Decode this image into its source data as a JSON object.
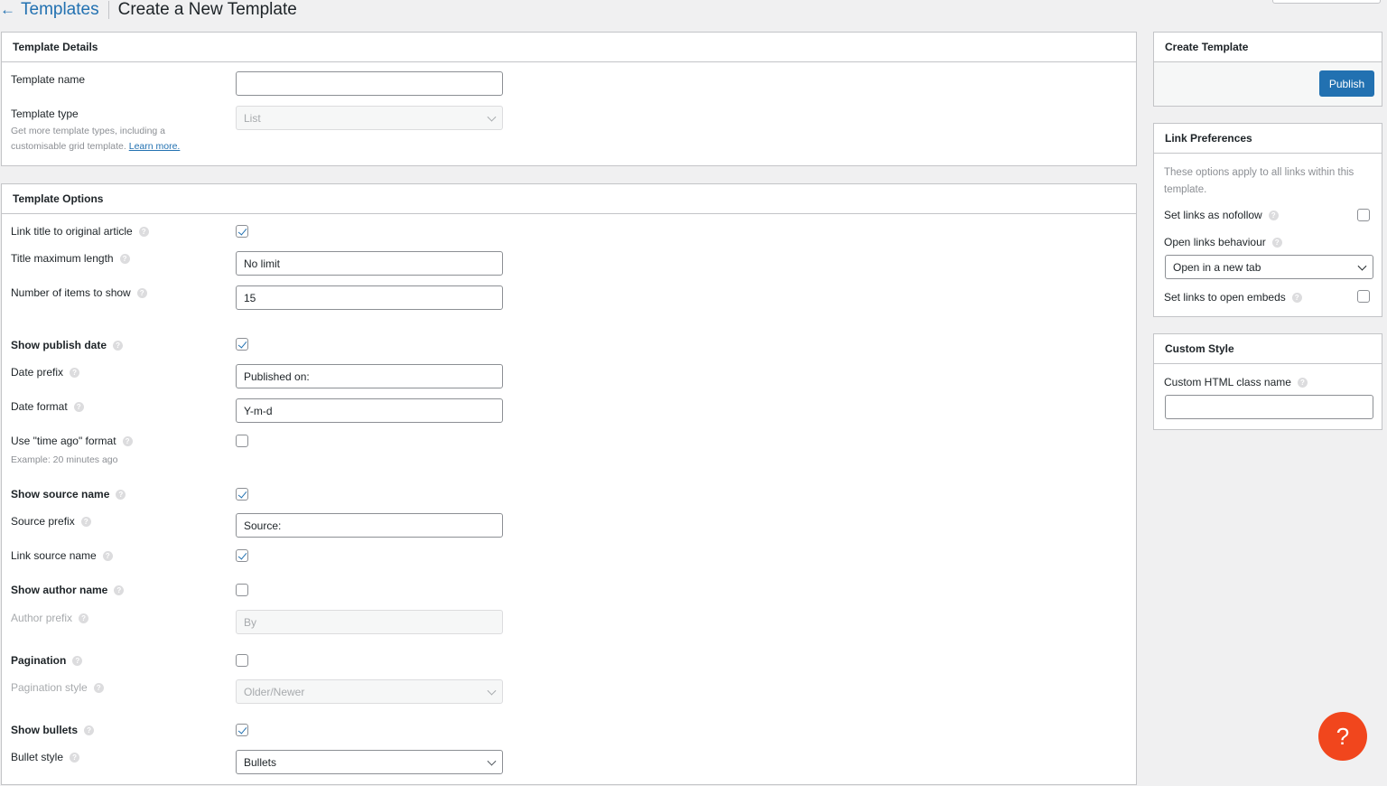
{
  "header": {
    "back_label": "Templates",
    "back_arrow": "←",
    "title": "Create a New Template"
  },
  "template_details": {
    "title": "Template Details",
    "name_label": "Template name",
    "name_value": "",
    "type_label": "Template type",
    "type_value": "List",
    "type_desc": "Get more template types, including a customisable grid template.",
    "learn_more": "Learn more."
  },
  "template_options": {
    "title": "Template Options",
    "link_title_label": "Link title to original article",
    "link_title_checked": true,
    "title_max_label": "Title maximum length",
    "title_max_value": "No limit",
    "num_items_label": "Number of items to show",
    "num_items_value": "15",
    "show_date_label": "Show publish date",
    "show_date_checked": true,
    "date_prefix_label": "Date prefix",
    "date_prefix_value": "Published on:",
    "date_format_label": "Date format",
    "date_format_value": "Y-m-d",
    "time_ago_label": "Use \"time ago\" format",
    "time_ago_checked": false,
    "time_ago_example": "Example: 20 minutes ago",
    "show_source_label": "Show source name",
    "show_source_checked": true,
    "source_prefix_label": "Source prefix",
    "source_prefix_value": "Source:",
    "link_source_label": "Link source name",
    "link_source_checked": true,
    "show_author_label": "Show author name",
    "show_author_checked": false,
    "author_prefix_label": "Author prefix",
    "author_prefix_placeholder": "By",
    "pagination_label": "Pagination",
    "pagination_checked": false,
    "pagination_style_label": "Pagination style",
    "pagination_style_value": "Older/Newer",
    "show_bullets_label": "Show bullets",
    "show_bullets_checked": true,
    "bullet_style_label": "Bullet style",
    "bullet_style_value": "Bullets"
  },
  "create_template": {
    "title": "Create Template",
    "publish_label": "Publish"
  },
  "link_prefs": {
    "title": "Link Preferences",
    "desc": "These options apply to all links within this template.",
    "nofollow_label": "Set links as nofollow",
    "nofollow_checked": false,
    "open_behaviour_label": "Open links behaviour",
    "open_behaviour_value": "Open in a new tab",
    "embeds_label": "Set links to open embeds",
    "embeds_checked": false
  },
  "custom_style": {
    "title": "Custom Style",
    "class_label": "Custom HTML class name",
    "class_value": ""
  },
  "help_fab": {
    "glyph": "?"
  },
  "help_glyph": "?",
  "colors": {
    "accent": "#2271b1",
    "help_fab": "#f1461d",
    "background": "#f0f0f1"
  }
}
